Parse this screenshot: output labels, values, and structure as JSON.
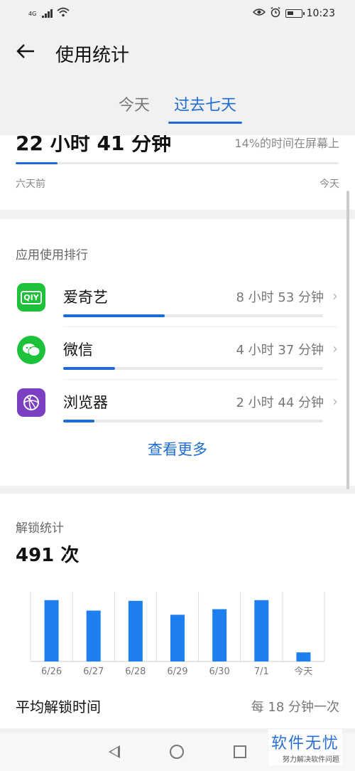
{
  "status_bar": {
    "network": "4G",
    "time": "10:23"
  },
  "header": {
    "back_icon": "arrow-left-icon",
    "title": "使用统计"
  },
  "tabs": [
    {
      "label": "今天",
      "active": false
    },
    {
      "label": "过去七天",
      "active": true
    }
  ],
  "summary": {
    "total_time": "22 小时 41 分钟",
    "screen_pct_text": "14%的时间在屏幕上",
    "start_label": "六天前",
    "end_label": "今天",
    "progress_fraction": 0.13
  },
  "ranking": {
    "title": "应用使用排行",
    "apps": [
      {
        "name": "爱奇艺",
        "time": "8 小时 53 分钟",
        "fraction": 0.39,
        "icon": "iqiyi-icon",
        "icon_text": "QIY",
        "color": "#1ec13a"
      },
      {
        "name": "微信",
        "time": "4 小时 37 分钟",
        "fraction": 0.2,
        "icon": "wechat-icon",
        "icon_text": "",
        "color": "#1ec13a"
      },
      {
        "name": "浏览器",
        "time": "2 小时 44 分钟",
        "fraction": 0.12,
        "icon": "browser-icon",
        "icon_text": "",
        "color": "#7b3fc4"
      }
    ],
    "view_more": "查看更多"
  },
  "unlock": {
    "title": "解锁统计",
    "count": "491 次",
    "avg_label": "平均解锁时间",
    "avg_value": "每 18 分钟一次"
  },
  "chart_data": {
    "type": "bar",
    "categories": [
      "6/26",
      "6/27",
      "6/28",
      "6/29",
      "6/30",
      "7/1",
      "今天"
    ],
    "values": [
      88,
      73,
      87,
      67,
      75,
      88,
      13
    ],
    "ylim": [
      0,
      100
    ],
    "color": "#1e7ff0",
    "grid": true
  },
  "watermark": {
    "main": "软件无忧",
    "sub": "努力解决软件问题"
  },
  "colors": {
    "accent": "#1e6bd6"
  }
}
